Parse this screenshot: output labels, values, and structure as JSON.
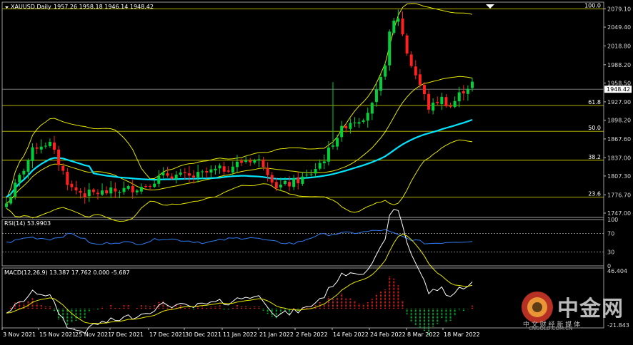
{
  "window": {
    "title": "XAUUSD,Daily",
    "ohlc": "1957.26 1958.18 1946.14 1948.42"
  },
  "price_scale": {
    "labels": [
      "2079.10",
      "2049.40",
      "2018.80",
      "1988.20",
      "1958.50",
      "1927.90",
      "1898.20",
      "1867.60",
      "1837.00",
      "1807.30",
      "1776.70",
      "1747.00"
    ],
    "current_price": "1948.42"
  },
  "fib_levels": [
    {
      "label": "100.0",
      "price": 2079.1
    },
    {
      "label": "61.8",
      "price": 1922.0
    },
    {
      "label": "50.0",
      "price": 1880.0
    },
    {
      "label": "38.2",
      "price": 1833.0
    },
    {
      "label": "23.6",
      "price": 1773.0
    }
  ],
  "rsi": {
    "title": "RSI(14) 53.9903",
    "scale": [
      "100",
      "70",
      "30",
      "0"
    ]
  },
  "macd": {
    "title": "MACD(12,26,9) 13.387 17.762 0.000 -5.687",
    "scale_top": "46.404",
    "scale_bottom": "-21.843"
  },
  "x_labels": [
    "3 Nov 2021",
    "15 Nov 2021",
    "25 Nov 2021",
    "7 Dec 2021",
    "17 Dec 2021",
    "30 Dec 2021",
    "11 Jan 2022",
    "21 Jan 2022",
    "2 Feb 2022",
    "14 Feb 2022",
    "24 Feb 2022",
    "8 Mar 2022",
    "18 Mar 2022"
  ],
  "watermark": {
    "logo_text": "中金网",
    "sub_text": "中 文 财 经 新 媒 体",
    "domain": "CNGOLD.COM.CN"
  },
  "colors": {
    "up": "#00d13a",
    "down": "#ff2020",
    "ma": "#00e5ff",
    "bb": "#e6e600",
    "fib": "#c8c800",
    "rsi": "#2f7cf0",
    "macd_signal": "#e6e600",
    "macd_line": "#ffffff"
  },
  "chart_data": [
    {
      "type": "candlestick",
      "title": "XAUUSD,Daily",
      "ylim": [
        1740,
        2090
      ],
      "x": [
        "3 Nov 2021",
        "15 Nov 2021",
        "25 Nov 2021",
        "7 Dec 2021",
        "17 Dec 2021",
        "30 Dec 2021",
        "11 Jan 2022",
        "21 Jan 2022",
        "2 Feb 2022",
        "14 Feb 2022",
        "24 Feb 2022",
        "8 Mar 2022",
        "18 Mar 2022"
      ],
      "close": [
        1763,
        1862,
        1785,
        1778,
        1800,
        1815,
        1822,
        1835,
        1806,
        1870,
        1890,
        2000,
        1958,
        1921,
        1948
      ],
      "notes": "Daily candles with Bollinger Bands, moving average and Fibonacci retracement"
    },
    {
      "type": "line",
      "title": "RSI(14) 53.9903",
      "ylim": [
        0,
        100
      ],
      "series": [
        {
          "name": "RSI(14)",
          "values": [
            50,
            62,
            58,
            70,
            45,
            52,
            48,
            60,
            55,
            50,
            58,
            62,
            52,
            48,
            66,
            70,
            72,
            78,
            60,
            48,
            52,
            54
          ]
        }
      ]
    },
    {
      "type": "bar",
      "title": "MACD(12,26,9) 13.387 17.762 0.000 -5.687",
      "ylim": [
        -21.843,
        46.404
      ]
    }
  ]
}
